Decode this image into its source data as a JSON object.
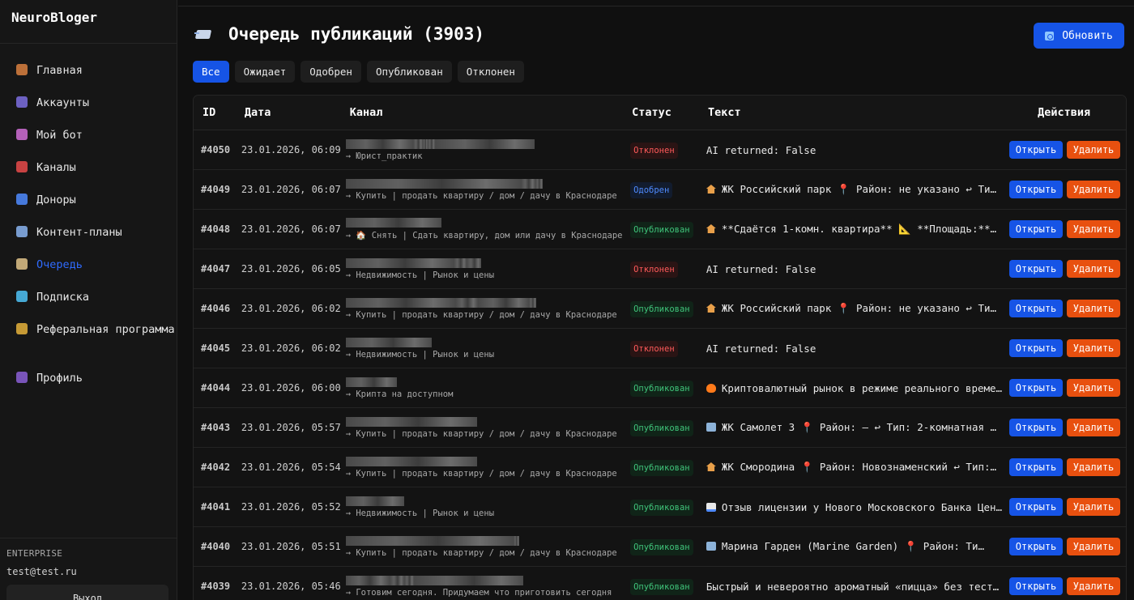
{
  "app": {
    "brand": "NeuroBloger"
  },
  "sidebar": {
    "items": [
      {
        "label": "Главная",
        "icon": "home-icon",
        "color": "#d9803f"
      },
      {
        "label": "Аккаунты",
        "icon": "phone-icon",
        "color": "#7d6fe0"
      },
      {
        "label": "Мой бот",
        "icon": "robot-icon",
        "color": "#d06fd6"
      },
      {
        "label": "Каналы",
        "icon": "megaphone-icon",
        "color": "#e84a4a"
      },
      {
        "label": "Доноры",
        "icon": "inbox-icon",
        "color": "#4f8bff"
      },
      {
        "label": "Контент-планы",
        "icon": "calendar-icon",
        "color": "#8ab4f0"
      },
      {
        "label": "Очередь",
        "icon": "clipboard-icon",
        "color": "#e0c38a"
      },
      {
        "label": "Подписка",
        "icon": "diamond-icon",
        "color": "#4fc3f7"
      },
      {
        "label": "Реферальная программа",
        "icon": "money-bag-icon",
        "color": "#e5b23b"
      },
      {
        "label": "Профиль",
        "icon": "user-icon",
        "color": "#8b5fd6"
      }
    ],
    "plan": "ENTERPRISE",
    "email": "test@test.ru",
    "logout_label": "Выход"
  },
  "header": {
    "title": "Очередь публикаций (3903)",
    "refresh_label": "Обновить"
  },
  "filters": [
    "Все",
    "Ожидает",
    "Одобрен",
    "Опубликован",
    "Отклонен"
  ],
  "table": {
    "columns": [
      "ID",
      "Дата",
      "Канал",
      "Статус",
      "Текст",
      "Действия"
    ],
    "open_label": "Открыть",
    "delete_label": "Удалить",
    "rows": [
      {
        "id": "#4050",
        "date": "23.01.2026, 06:09",
        "channel_sub": "→ Юрист_практик",
        "status": "Отклонен",
        "status_kind": "rej",
        "emoji": "",
        "text": "AI returned: False"
      },
      {
        "id": "#4049",
        "date": "23.01.2026, 06:07",
        "channel_sub": "→ Купить | продать квартиру / дом / дачу в Краснодаре",
        "status": "Одобрен",
        "status_kind": "app",
        "emoji": "house",
        "text": "ЖК Российский парк 📍 Район: не указано ↩ Ти…"
      },
      {
        "id": "#4048",
        "date": "23.01.2026, 06:07",
        "channel_sub": "→ 🏠 Снять | Сдать квартиру, дом или дачу в Краснодаре",
        "status": "Опубликован",
        "status_kind": "pub",
        "emoji": "house",
        "text": "**Сдаётся 1-комн. квартира** 📐 **Площадь:** …"
      },
      {
        "id": "#4047",
        "date": "23.01.2026, 06:05",
        "channel_sub": "→ Недвижимость | Рынок и цены",
        "status": "Отклонен",
        "status_kind": "rej",
        "emoji": "",
        "text": "AI returned: False"
      },
      {
        "id": "#4046",
        "date": "23.01.2026, 06:02",
        "channel_sub": "→ Купить | продать квартиру / дом / дачу в Краснодаре",
        "status": "Опубликован",
        "status_kind": "pub",
        "emoji": "house",
        "text": "ЖК Российский парк 📍 Район: не указано ↩ Ти…"
      },
      {
        "id": "#4045",
        "date": "23.01.2026, 06:02",
        "channel_sub": "→ Недвижимость | Рынок и цены",
        "status": "Отклонен",
        "status_kind": "rej",
        "emoji": "",
        "text": "AI returned: False"
      },
      {
        "id": "#4044",
        "date": "23.01.2026, 06:00",
        "channel_sub": "→ Крипта на доступном",
        "status": "Опубликован",
        "status_kind": "pub",
        "emoji": "fire",
        "text": "Криптовалютный рынок в режиме реального време…"
      },
      {
        "id": "#4043",
        "date": "23.01.2026, 05:57",
        "channel_sub": "→ Купить | продать квартиру / дом / дачу в Краснодаре",
        "status": "Опубликован",
        "status_kind": "pub",
        "emoji": "office",
        "text": "ЖК Самолет 3 📍 Район: — ↩ Тип: 2-комнатная …"
      },
      {
        "id": "#4042",
        "date": "23.01.2026, 05:54",
        "channel_sub": "→ Купить | продать квартиру / дом / дачу в Краснодаре",
        "status": "Опубликован",
        "status_kind": "pub",
        "emoji": "house",
        "text": "ЖК Смородина 📍 Район: Новознаменский ↩ Тип:…"
      },
      {
        "id": "#4041",
        "date": "23.01.2026, 05:52",
        "channel_sub": "→ Недвижимость | Рынок и цены",
        "status": "Опубликован",
        "status_kind": "pub",
        "emoji": "chart",
        "text": "Отзыв лицензии у Нового Московского Банка Цен…"
      },
      {
        "id": "#4040",
        "date": "23.01.2026, 05:51",
        "channel_sub": "→ Купить | продать квартиру / дом / дачу в Краснодаре",
        "status": "Опубликован",
        "status_kind": "pub",
        "emoji": "office",
        "text": "Марина Гарден (Marine Garden) 📍 Район: Ти…"
      },
      {
        "id": "#4039",
        "date": "23.01.2026, 05:46",
        "channel_sub": "→ Готовим сегодня. Придумаем что приготовить сегодня",
        "status": "Опубликован",
        "status_kind": "pub",
        "emoji": "",
        "text": "Быстрый и невероятно ароматный «пицца» без теста…"
      }
    ]
  },
  "colors": {
    "accent": "#1654e6",
    "danger": "#e8500f",
    "rejected": "#ff5a5a",
    "approved": "#4f8bff",
    "published": "#3fc47a"
  }
}
